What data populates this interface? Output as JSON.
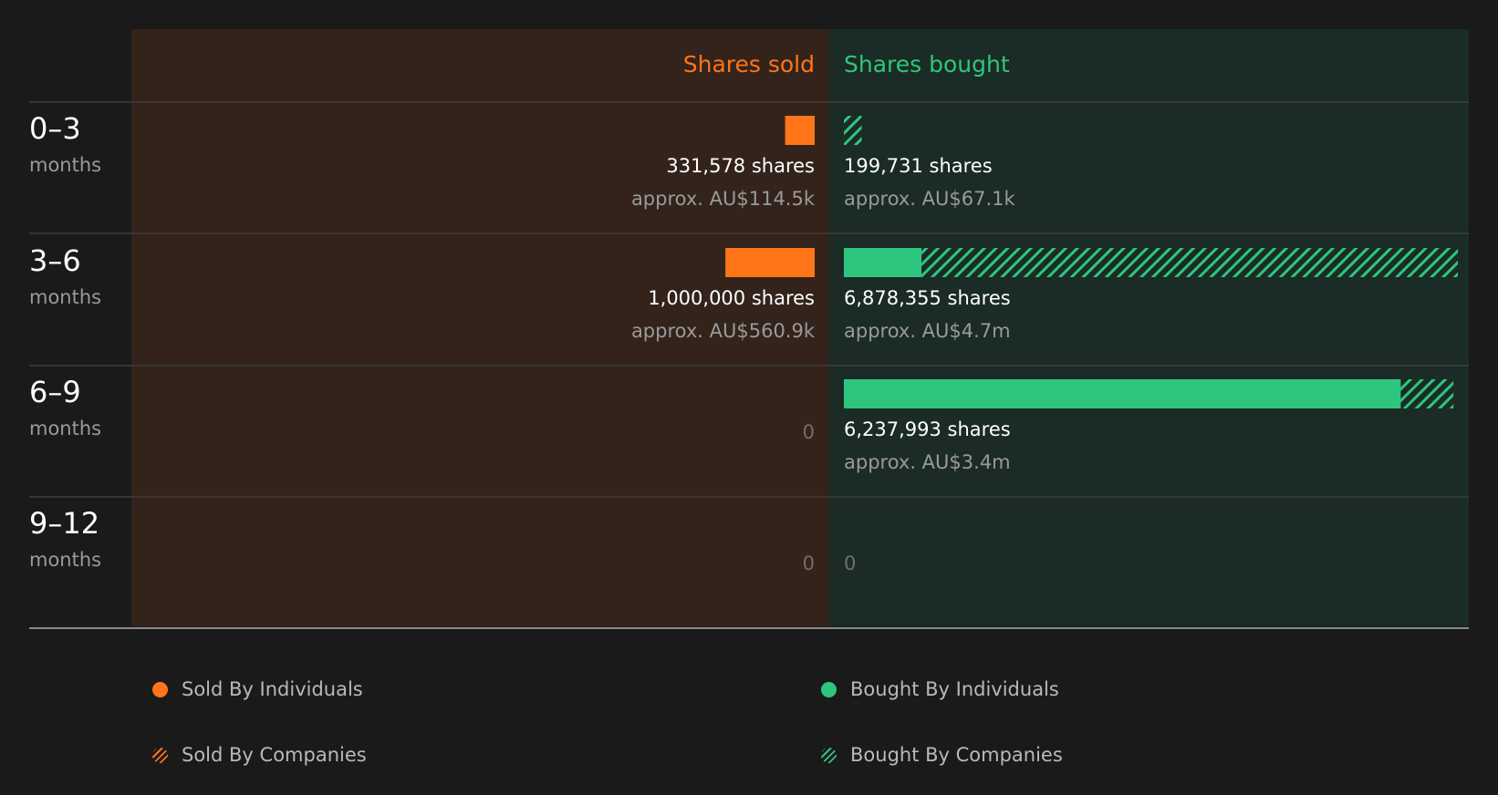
{
  "colors": {
    "background": "#1a1a1a",
    "sold_panel": "#33231b",
    "bought_panel": "#1b2b25",
    "sold": "#ff7518",
    "bought": "#2ec67e",
    "text_primary": "#ffffff",
    "text_secondary": "#9a9a9a",
    "text_zero": "#6f6f6f",
    "divider": "#3e3e3e",
    "axis": "#8a8a8a"
  },
  "chart_data": {
    "type": "bar",
    "orientation": "horizontal",
    "layout": "diverging",
    "headers": {
      "sold": "Shares sold",
      "bought": "Shares bought"
    },
    "unit_label": "months",
    "shares_suffix": "shares",
    "scale_max": 7000000,
    "categories": [
      "0–3",
      "3–6",
      "6–9",
      "9–12"
    ],
    "series": [
      {
        "name": "Sold By Individuals",
        "side": "sold",
        "style": "solid",
        "values": [
          331578,
          1000000,
          0,
          0
        ]
      },
      {
        "name": "Sold By Companies",
        "side": "sold",
        "style": "hatched",
        "values": [
          0,
          0,
          0,
          0
        ]
      },
      {
        "name": "Bought By Individuals",
        "side": "bought",
        "style": "solid",
        "values": [
          0,
          870000,
          6237993,
          0
        ]
      },
      {
        "name": "Bought By Companies",
        "side": "bought",
        "style": "hatched",
        "values": [
          199731,
          6008355,
          0,
          0
        ]
      }
    ],
    "sold_totals": {
      "shares": [
        "331,578",
        "1,000,000",
        "0",
        "0"
      ],
      "value": [
        "approx. AU$114.5k",
        "approx. AU$560.9k",
        "",
        ""
      ]
    },
    "bought_totals": {
      "shares": [
        "199,731",
        "6,878,355",
        "6,237,993",
        "0"
      ],
      "value": [
        "approx. AU$67.1k",
        "approx. AU$4.7m",
        "approx. AU$3.4m",
        ""
      ]
    },
    "bar_overrides": {
      "bought_companies_extra_6_9": 590000
    },
    "legend": {
      "sold_individuals": "Sold By Individuals",
      "sold_companies": "Sold By Companies",
      "bought_individuals": "Bought By Individuals",
      "bought_companies": "Bought By Companies"
    }
  }
}
